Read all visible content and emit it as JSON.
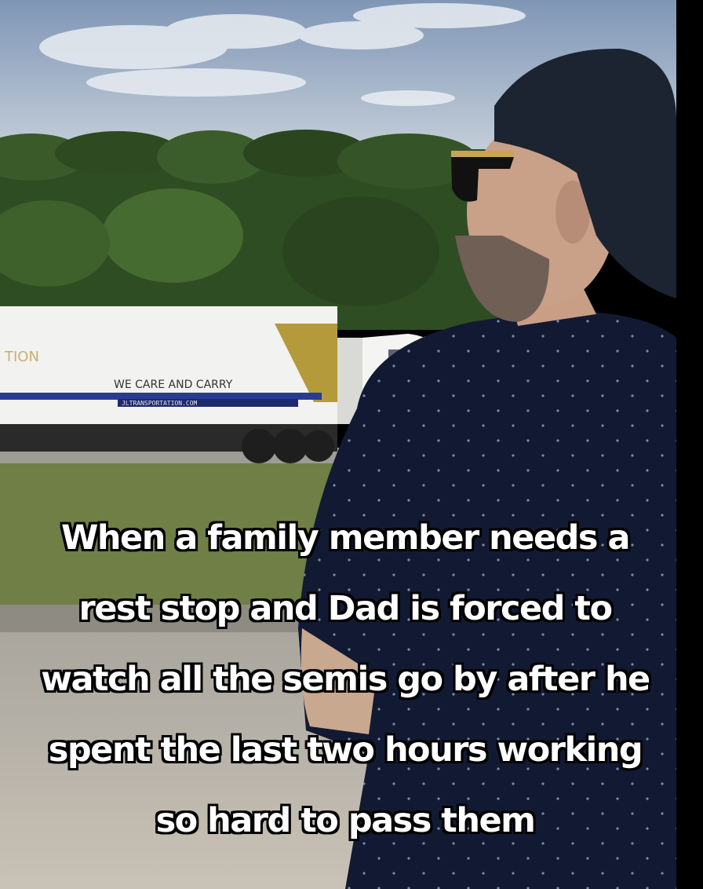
{
  "caption": {
    "lines": [
      "When a family member needs a",
      "rest stop and Dad is forced to",
      "watch all the semis go by after he",
      "spent the last two hours working",
      "so hard to pass them"
    ]
  },
  "truck": {
    "trailer_text_left": "TION",
    "trailer_slogan": "WE CARE AND CARRY",
    "trailer_url": "JLTRANSPORTATION.COM"
  },
  "colors": {
    "sky": "#8fa3bd",
    "trees": "#2f4d22",
    "grass": "#6f7f45",
    "pavement": "#b8b2a6",
    "shirt": "#121a33",
    "trailer": "#f2f2f0",
    "trailer_stripe": "#2a3b8f",
    "trailer_gold": "#b59a3c"
  }
}
